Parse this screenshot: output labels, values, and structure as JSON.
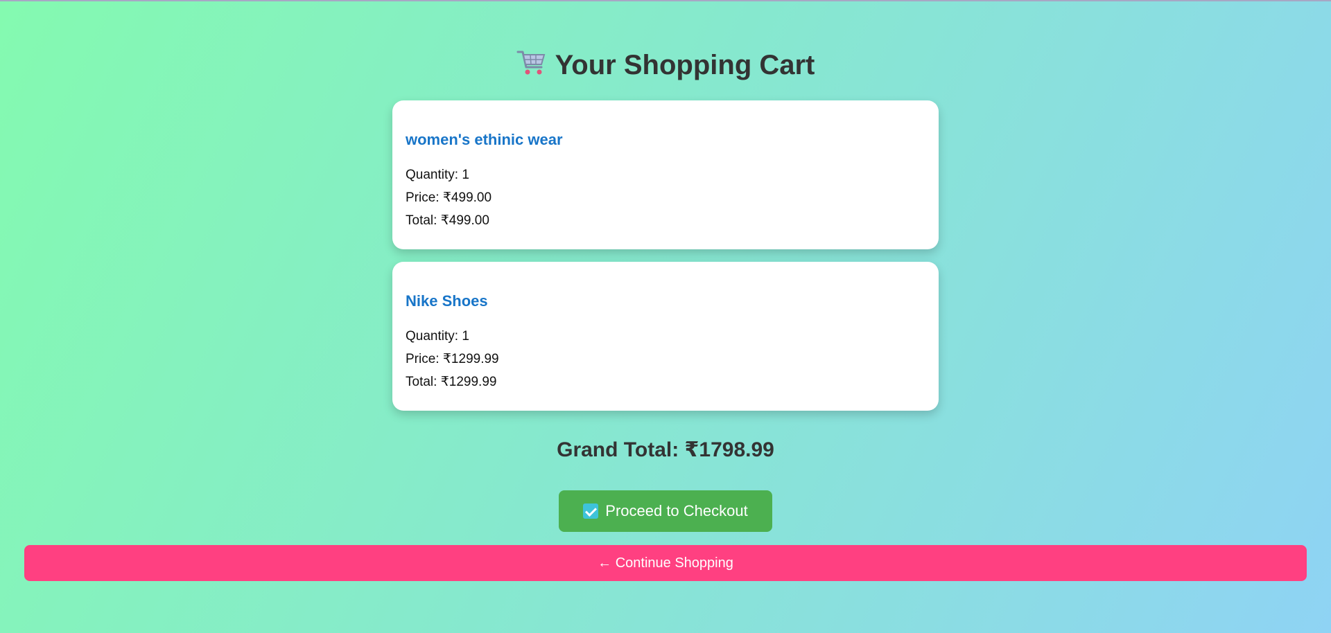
{
  "page": {
    "title": "Your Shopping Cart",
    "title_icon": "shopping-cart-icon"
  },
  "cart": {
    "items": [
      {
        "name": "women's ethinic wear",
        "quantity": "Quantity: 1",
        "price": "Price: ₹499.00",
        "total": "Total: ₹499.00"
      },
      {
        "name": "Nike Shoes",
        "quantity": "Quantity: 1",
        "price": "Price: ₹1299.99",
        "total": "Total: ₹1299.99"
      }
    ],
    "grand_total": "Grand Total: ₹1798.99"
  },
  "actions": {
    "checkout_label": "Proceed to Checkout",
    "checkout_icon": "check-mark-icon",
    "continue_label": "← Continue Shopping"
  },
  "colors": {
    "item_name": "#1875c8",
    "checkout_button": "#4cb050",
    "continue_button": "#ff4081"
  }
}
